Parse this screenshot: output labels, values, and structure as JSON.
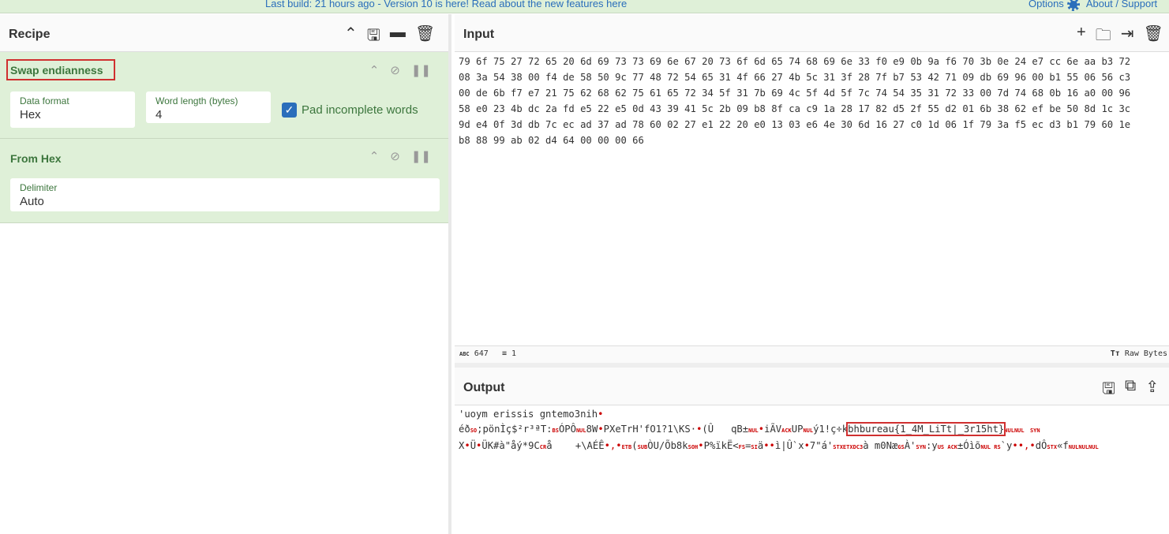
{
  "banner": {
    "message": "Last build: 21 hours ago - Version 10 is here! Read about the new features here",
    "options": "Options",
    "about": "About / Support"
  },
  "recipe": {
    "title": "Recipe",
    "ops": [
      {
        "name": "Swap endianness",
        "fields": [
          {
            "label": "Data format",
            "value": "Hex"
          },
          {
            "label": "Word length (bytes)",
            "value": "4"
          }
        ],
        "checkbox": {
          "label": "Pad incomplete words",
          "checked": true
        }
      },
      {
        "name": "From Hex",
        "fields": [
          {
            "label": "Delimiter",
            "value": "Auto"
          }
        ]
      }
    ]
  },
  "input": {
    "title": "Input",
    "lines": [
      "79 6f 75 27 72 65 20 6d 69 73 73 69 6e 67 20 73 6f 6d 65 74 68 69 6e 33 f0 e9 0b 9a f6 70 3b 0e 24 e7 cc 6e aa b3 72",
      "08 3a 54 38 00 f4 de 58 50 9c 77 48 72 54 65 31 4f 66 27 4b 5c 31 3f 28 7f b7 53 42 71 09 db 69 96 00 b1 55 06 56 c3",
      "00 de 6b f7 e7 21 75 62 68 62 75 61 65 72 34 5f 31 7b 69 4c 5f 4d 5f 7c 74 54 35 31 72 33 00 7d 74 68 0b 16 a0 00 96",
      "58 e0 23 4b dc 2a fd e5 22 e5 0d 43 39 41 5c 2b 09 b8 8f ca c9 1a 28 17 82 d5 2f 55 d2 01 6b 38 62 ef be 50 8d 1c 3c",
      "9d e4 0f 3d db 7c ec ad 37 ad 78 60 02 27 e1 22 20 e0 13 03 e6 4e 30 6d 16 27 c0 1d 06 1f 79 3a f5 ec d3 b1 79 60 1e",
      "b8 88 99 ab 02 d4 64 00 00 00 66"
    ],
    "status": {
      "chars": "647",
      "lines": "1",
      "encoding": "Raw Bytes"
    }
  },
  "output": {
    "title": "Output",
    "lines": [
      [
        {
          "t": "'uoym erissis gntemo3nih"
        },
        {
          "d": "•"
        }
      ],
      [
        {
          "t": "éð"
        },
        {
          "c": "SO"
        },
        {
          "t": ";pönÌç$²r³ªT:"
        },
        {
          "c": "BS"
        },
        {
          "t": "ÓPÔ"
        },
        {
          "c": "NUL"
        },
        {
          "t": "8W"
        },
        {
          "d": "•"
        },
        {
          "t": "PXeTrH'fO1?1\\KS·"
        },
        {
          "d": "•"
        },
        {
          "t": "(Û   qB±"
        },
        {
          "c": "NUL"
        },
        {
          "d": "•"
        },
        {
          "t": "iÃV"
        },
        {
          "c": "ACK"
        },
        {
          "t": "UP"
        },
        {
          "c": "NUL"
        },
        {
          "t": "ý1!ç÷k"
        },
        {
          "f": "bhbureau{1_4M_LiTt|_3r15ht}"
        },
        {
          "c": "NUL"
        },
        {
          "c": "NUL"
        },
        {
          "t": " "
        },
        {
          "c": "SYN"
        }
      ],
      [
        {
          "t": "X"
        },
        {
          "d": "•"
        },
        {
          "t": "Ü"
        },
        {
          "d": "•"
        },
        {
          "t": "ÜK#à\"åý*9C"
        },
        {
          "c": "CR"
        },
        {
          "t": "å    +\\AÉÊ"
        },
        {
          "d": "•‚•"
        },
        {
          "c": "ETB"
        },
        {
          "t": "("
        },
        {
          "c": "SUB"
        },
        {
          "t": "ÒU/Õb8k"
        },
        {
          "c": "SOH"
        },
        {
          "d": "•"
        },
        {
          "t": "P%ïkË<"
        },
        {
          "c": "FS"
        },
        {
          "t": "="
        },
        {
          "c": "SI"
        },
        {
          "t": "ä"
        },
        {
          "d": "••"
        },
        {
          "t": "ì|Û`x"
        },
        {
          "d": "•"
        },
        {
          "t": "7\"á'"
        },
        {
          "c": "STXETXDC3"
        },
        {
          "t": "à m0Næ"
        },
        {
          "c": "GS"
        },
        {
          "t": "À'"
        },
        {
          "c": "SYN"
        },
        {
          "t": ":y"
        },
        {
          "c": "US ACK"
        },
        {
          "t": "±Óìõ"
        },
        {
          "c": "NUL RS"
        },
        {
          "t": "`y"
        },
        {
          "d": "••‚•"
        },
        {
          "t": "dÔ"
        },
        {
          "c": "STX"
        },
        {
          "t": "«f"
        },
        {
          "c": "NULNULNUL"
        }
      ]
    ]
  }
}
